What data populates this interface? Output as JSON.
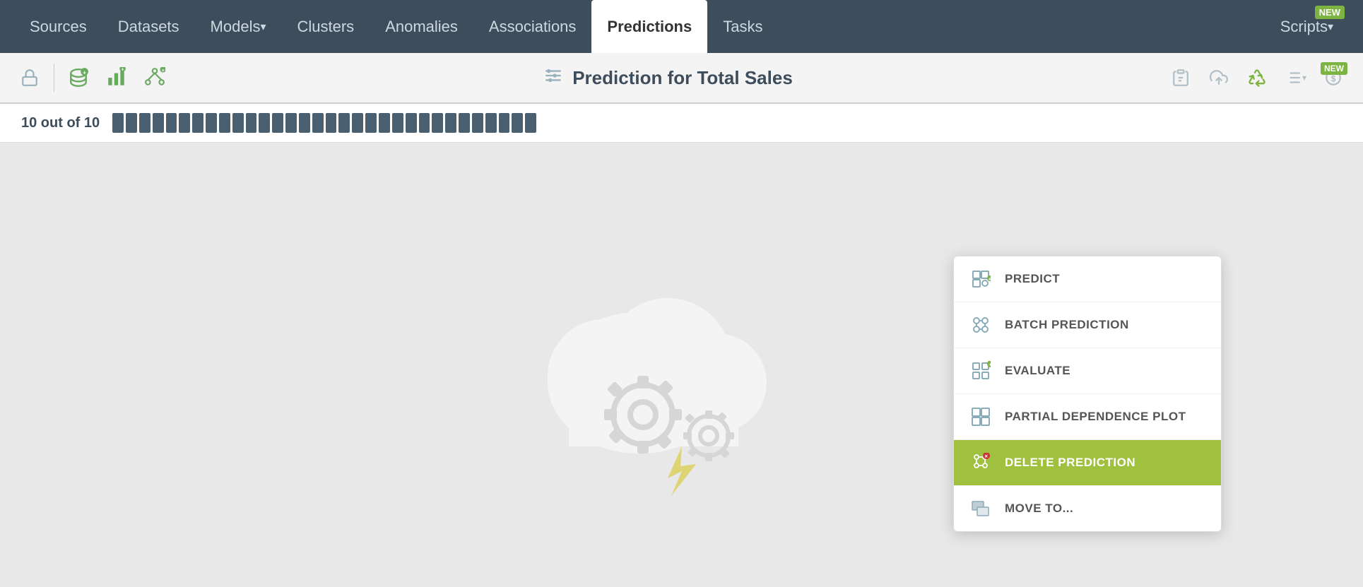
{
  "nav": {
    "items": [
      {
        "label": "Sources",
        "active": false,
        "hasArrow": false
      },
      {
        "label": "Datasets",
        "active": false,
        "hasArrow": false
      },
      {
        "label": "Models",
        "active": false,
        "hasArrow": true
      },
      {
        "label": "Clusters",
        "active": false,
        "hasArrow": false
      },
      {
        "label": "Anomalies",
        "active": false,
        "hasArrow": false
      },
      {
        "label": "Associations",
        "active": false,
        "hasArrow": false
      },
      {
        "label": "Predictions",
        "active": true,
        "hasArrow": false
      },
      {
        "label": "Tasks",
        "active": false,
        "hasArrow": false
      }
    ],
    "scripts_label": "Scripts",
    "new_badge": "NEW"
  },
  "toolbar": {
    "title": "Prediction for Total Sales",
    "new_badge": "NEW"
  },
  "progress": {
    "label": "10 out of 10",
    "segments": 32
  },
  "dropdown": {
    "items": [
      {
        "label": "PREDICT",
        "icon": "predict",
        "active": false
      },
      {
        "label": "BATCH PREDICTION",
        "icon": "batch",
        "active": false
      },
      {
        "label": "EVALUATE",
        "icon": "evaluate",
        "active": false
      },
      {
        "label": "PARTIAL DEPENDENCE PLOT",
        "icon": "pdp",
        "active": false
      },
      {
        "label": "DELETE PREDICTION",
        "icon": "delete",
        "active": true
      },
      {
        "label": "MOVE TO...",
        "icon": "move",
        "active": false
      }
    ]
  }
}
